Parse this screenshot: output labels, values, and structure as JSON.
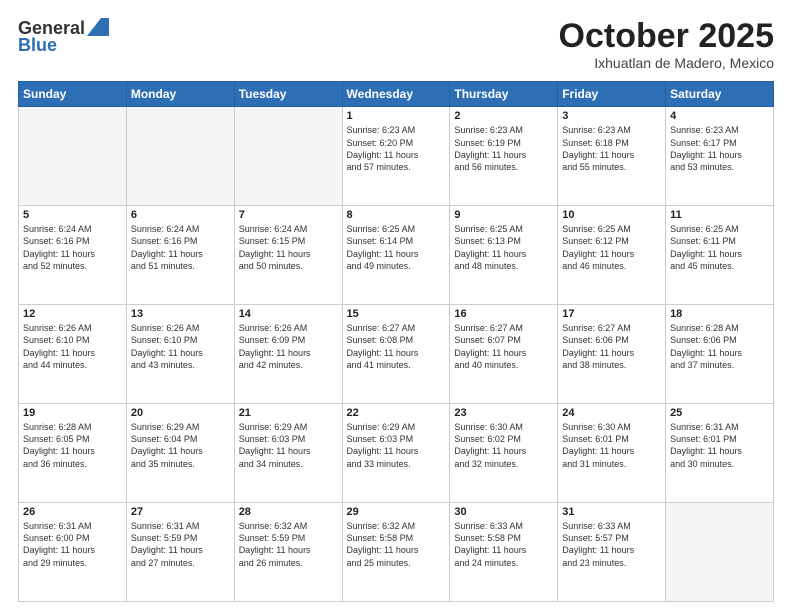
{
  "logo": {
    "line1": "General",
    "line2": "Blue"
  },
  "header": {
    "title": "October 2025",
    "location": "Ixhuatlan de Madero, Mexico"
  },
  "weekdays": [
    "Sunday",
    "Monday",
    "Tuesday",
    "Wednesday",
    "Thursday",
    "Friday",
    "Saturday"
  ],
  "weeks": [
    [
      {
        "day": "",
        "info": ""
      },
      {
        "day": "",
        "info": ""
      },
      {
        "day": "",
        "info": ""
      },
      {
        "day": "1",
        "info": "Sunrise: 6:23 AM\nSunset: 6:20 PM\nDaylight: 11 hours\nand 57 minutes."
      },
      {
        "day": "2",
        "info": "Sunrise: 6:23 AM\nSunset: 6:19 PM\nDaylight: 11 hours\nand 56 minutes."
      },
      {
        "day": "3",
        "info": "Sunrise: 6:23 AM\nSunset: 6:18 PM\nDaylight: 11 hours\nand 55 minutes."
      },
      {
        "day": "4",
        "info": "Sunrise: 6:23 AM\nSunset: 6:17 PM\nDaylight: 11 hours\nand 53 minutes."
      }
    ],
    [
      {
        "day": "5",
        "info": "Sunrise: 6:24 AM\nSunset: 6:16 PM\nDaylight: 11 hours\nand 52 minutes."
      },
      {
        "day": "6",
        "info": "Sunrise: 6:24 AM\nSunset: 6:16 PM\nDaylight: 11 hours\nand 51 minutes."
      },
      {
        "day": "7",
        "info": "Sunrise: 6:24 AM\nSunset: 6:15 PM\nDaylight: 11 hours\nand 50 minutes."
      },
      {
        "day": "8",
        "info": "Sunrise: 6:25 AM\nSunset: 6:14 PM\nDaylight: 11 hours\nand 49 minutes."
      },
      {
        "day": "9",
        "info": "Sunrise: 6:25 AM\nSunset: 6:13 PM\nDaylight: 11 hours\nand 48 minutes."
      },
      {
        "day": "10",
        "info": "Sunrise: 6:25 AM\nSunset: 6:12 PM\nDaylight: 11 hours\nand 46 minutes."
      },
      {
        "day": "11",
        "info": "Sunrise: 6:25 AM\nSunset: 6:11 PM\nDaylight: 11 hours\nand 45 minutes."
      }
    ],
    [
      {
        "day": "12",
        "info": "Sunrise: 6:26 AM\nSunset: 6:10 PM\nDaylight: 11 hours\nand 44 minutes."
      },
      {
        "day": "13",
        "info": "Sunrise: 6:26 AM\nSunset: 6:10 PM\nDaylight: 11 hours\nand 43 minutes."
      },
      {
        "day": "14",
        "info": "Sunrise: 6:26 AM\nSunset: 6:09 PM\nDaylight: 11 hours\nand 42 minutes."
      },
      {
        "day": "15",
        "info": "Sunrise: 6:27 AM\nSunset: 6:08 PM\nDaylight: 11 hours\nand 41 minutes."
      },
      {
        "day": "16",
        "info": "Sunrise: 6:27 AM\nSunset: 6:07 PM\nDaylight: 11 hours\nand 40 minutes."
      },
      {
        "day": "17",
        "info": "Sunrise: 6:27 AM\nSunset: 6:06 PM\nDaylight: 11 hours\nand 38 minutes."
      },
      {
        "day": "18",
        "info": "Sunrise: 6:28 AM\nSunset: 6:06 PM\nDaylight: 11 hours\nand 37 minutes."
      }
    ],
    [
      {
        "day": "19",
        "info": "Sunrise: 6:28 AM\nSunset: 6:05 PM\nDaylight: 11 hours\nand 36 minutes."
      },
      {
        "day": "20",
        "info": "Sunrise: 6:29 AM\nSunset: 6:04 PM\nDaylight: 11 hours\nand 35 minutes."
      },
      {
        "day": "21",
        "info": "Sunrise: 6:29 AM\nSunset: 6:03 PM\nDaylight: 11 hours\nand 34 minutes."
      },
      {
        "day": "22",
        "info": "Sunrise: 6:29 AM\nSunset: 6:03 PM\nDaylight: 11 hours\nand 33 minutes."
      },
      {
        "day": "23",
        "info": "Sunrise: 6:30 AM\nSunset: 6:02 PM\nDaylight: 11 hours\nand 32 minutes."
      },
      {
        "day": "24",
        "info": "Sunrise: 6:30 AM\nSunset: 6:01 PM\nDaylight: 11 hours\nand 31 minutes."
      },
      {
        "day": "25",
        "info": "Sunrise: 6:31 AM\nSunset: 6:01 PM\nDaylight: 11 hours\nand 30 minutes."
      }
    ],
    [
      {
        "day": "26",
        "info": "Sunrise: 6:31 AM\nSunset: 6:00 PM\nDaylight: 11 hours\nand 29 minutes."
      },
      {
        "day": "27",
        "info": "Sunrise: 6:31 AM\nSunset: 5:59 PM\nDaylight: 11 hours\nand 27 minutes."
      },
      {
        "day": "28",
        "info": "Sunrise: 6:32 AM\nSunset: 5:59 PM\nDaylight: 11 hours\nand 26 minutes."
      },
      {
        "day": "29",
        "info": "Sunrise: 6:32 AM\nSunset: 5:58 PM\nDaylight: 11 hours\nand 25 minutes."
      },
      {
        "day": "30",
        "info": "Sunrise: 6:33 AM\nSunset: 5:58 PM\nDaylight: 11 hours\nand 24 minutes."
      },
      {
        "day": "31",
        "info": "Sunrise: 6:33 AM\nSunset: 5:57 PM\nDaylight: 11 hours\nand 23 minutes."
      },
      {
        "day": "",
        "info": ""
      }
    ]
  ]
}
